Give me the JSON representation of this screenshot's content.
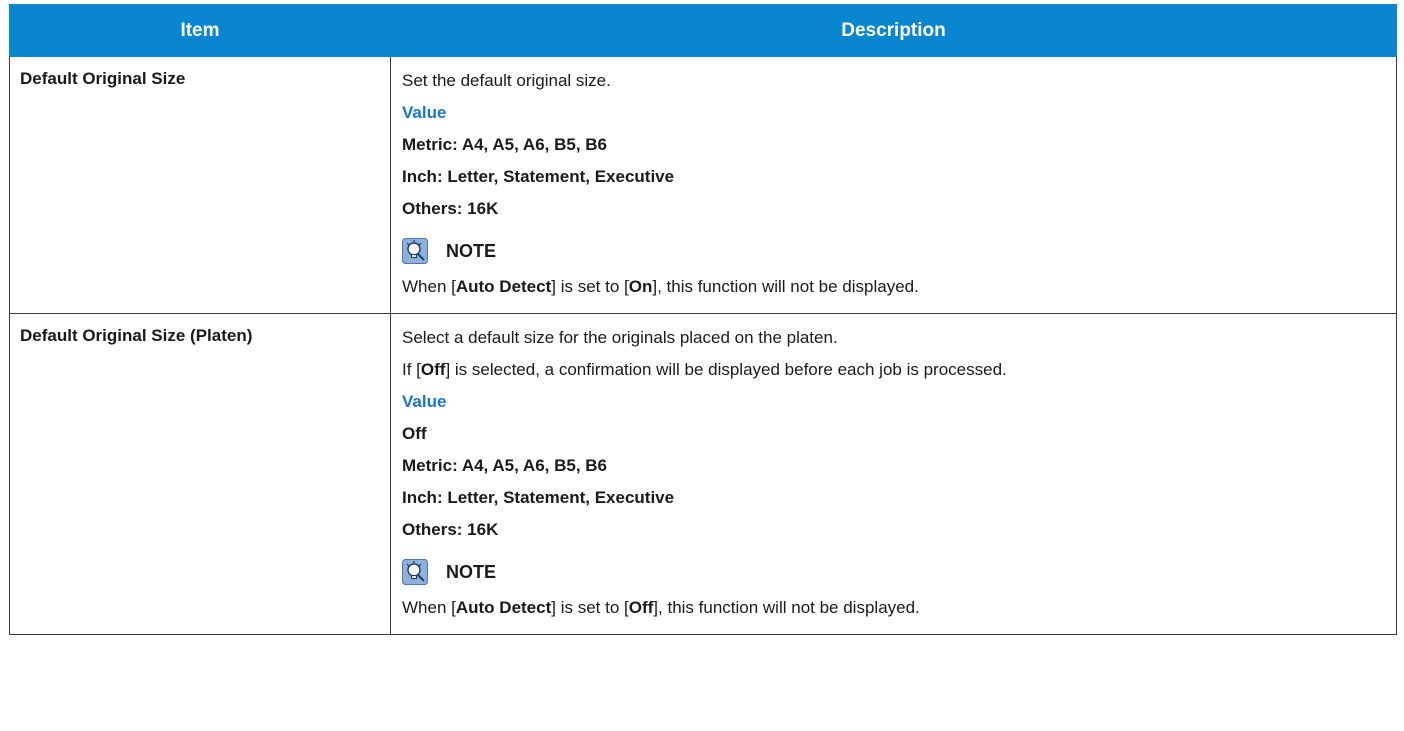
{
  "header": {
    "item": "Item",
    "description": "Description"
  },
  "rows": [
    {
      "item": "Default Original Size",
      "intro": "Set the default original size.",
      "value_label": "Value",
      "values": [
        "Metric: A4, A5, A6, B5, B6",
        "Inch: Letter, Statement, Executive",
        "Others: 16K"
      ],
      "note_label": "NOTE",
      "note": {
        "pre": "When [",
        "bold1": "Auto Detect",
        "mid": "] is set to [",
        "bold2": "On",
        "post": "], this function will not be displayed."
      }
    },
    {
      "item": "Default Original Size (Platen)",
      "intro": "Select a default size for the originals placed on the platen.",
      "intro2": {
        "pre": "If [",
        "bold": "Off",
        "post": "] is selected, a confirmation will be displayed before each job is processed."
      },
      "value_label": "Value",
      "values": [
        "Off",
        "Metric: A4, A5, A6, B5, B6",
        "Inch: Letter, Statement, Executive",
        "Others: 16K"
      ],
      "note_label": "NOTE",
      "note": {
        "pre": "When [",
        "bold1": "Auto Detect",
        "mid": "] is set to [",
        "bold2": "Off",
        "post": "], this function will not be displayed."
      }
    }
  ],
  "colors": {
    "header_bg": "#0a86d0",
    "value_label": "#1876d2"
  },
  "icons": {
    "note": "note-lightbulb-icon"
  }
}
